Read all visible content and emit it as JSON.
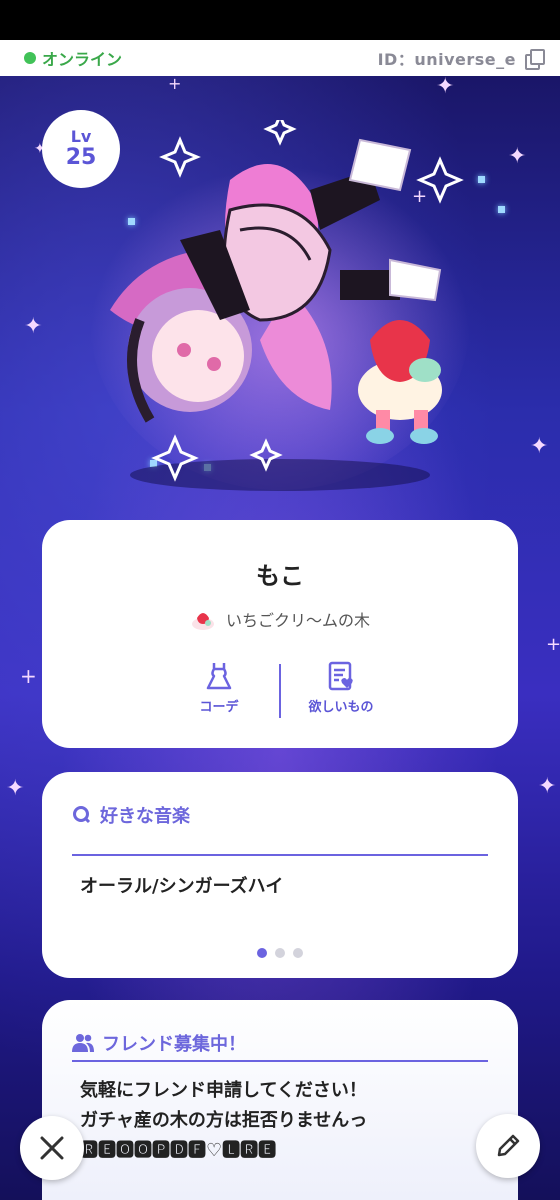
{
  "status": {
    "online_label": "オンライン",
    "user_id": "ID：universe_e"
  },
  "level": {
    "label": "Lv",
    "value": "25"
  },
  "profile": {
    "name": "もこ",
    "tree_name": "いちごクリ〜ムの木",
    "actions": [
      {
        "label": "コーデ",
        "icon": "dress-icon"
      },
      {
        "label": "欲しいもの",
        "icon": "wishlist-icon"
      }
    ]
  },
  "music": {
    "title": "好きな音楽",
    "text": "オーラル/シンガーズハイ",
    "page_count": 3,
    "active_page": 1
  },
  "friend": {
    "title": "フレンド募集中！",
    "line1": "気軽にフレンド申請してください！",
    "line2": "ガチャ産の木の方は拒否りませんっ",
    "line3": "🆁🅴🅾🅾🅿🅳🅵♡🅻🆁🅴"
  },
  "colors": {
    "accent": "#6b63e0",
    "online": "#41c258",
    "background_top": "#1a1668",
    "background_mid": "#3a2ec0"
  }
}
